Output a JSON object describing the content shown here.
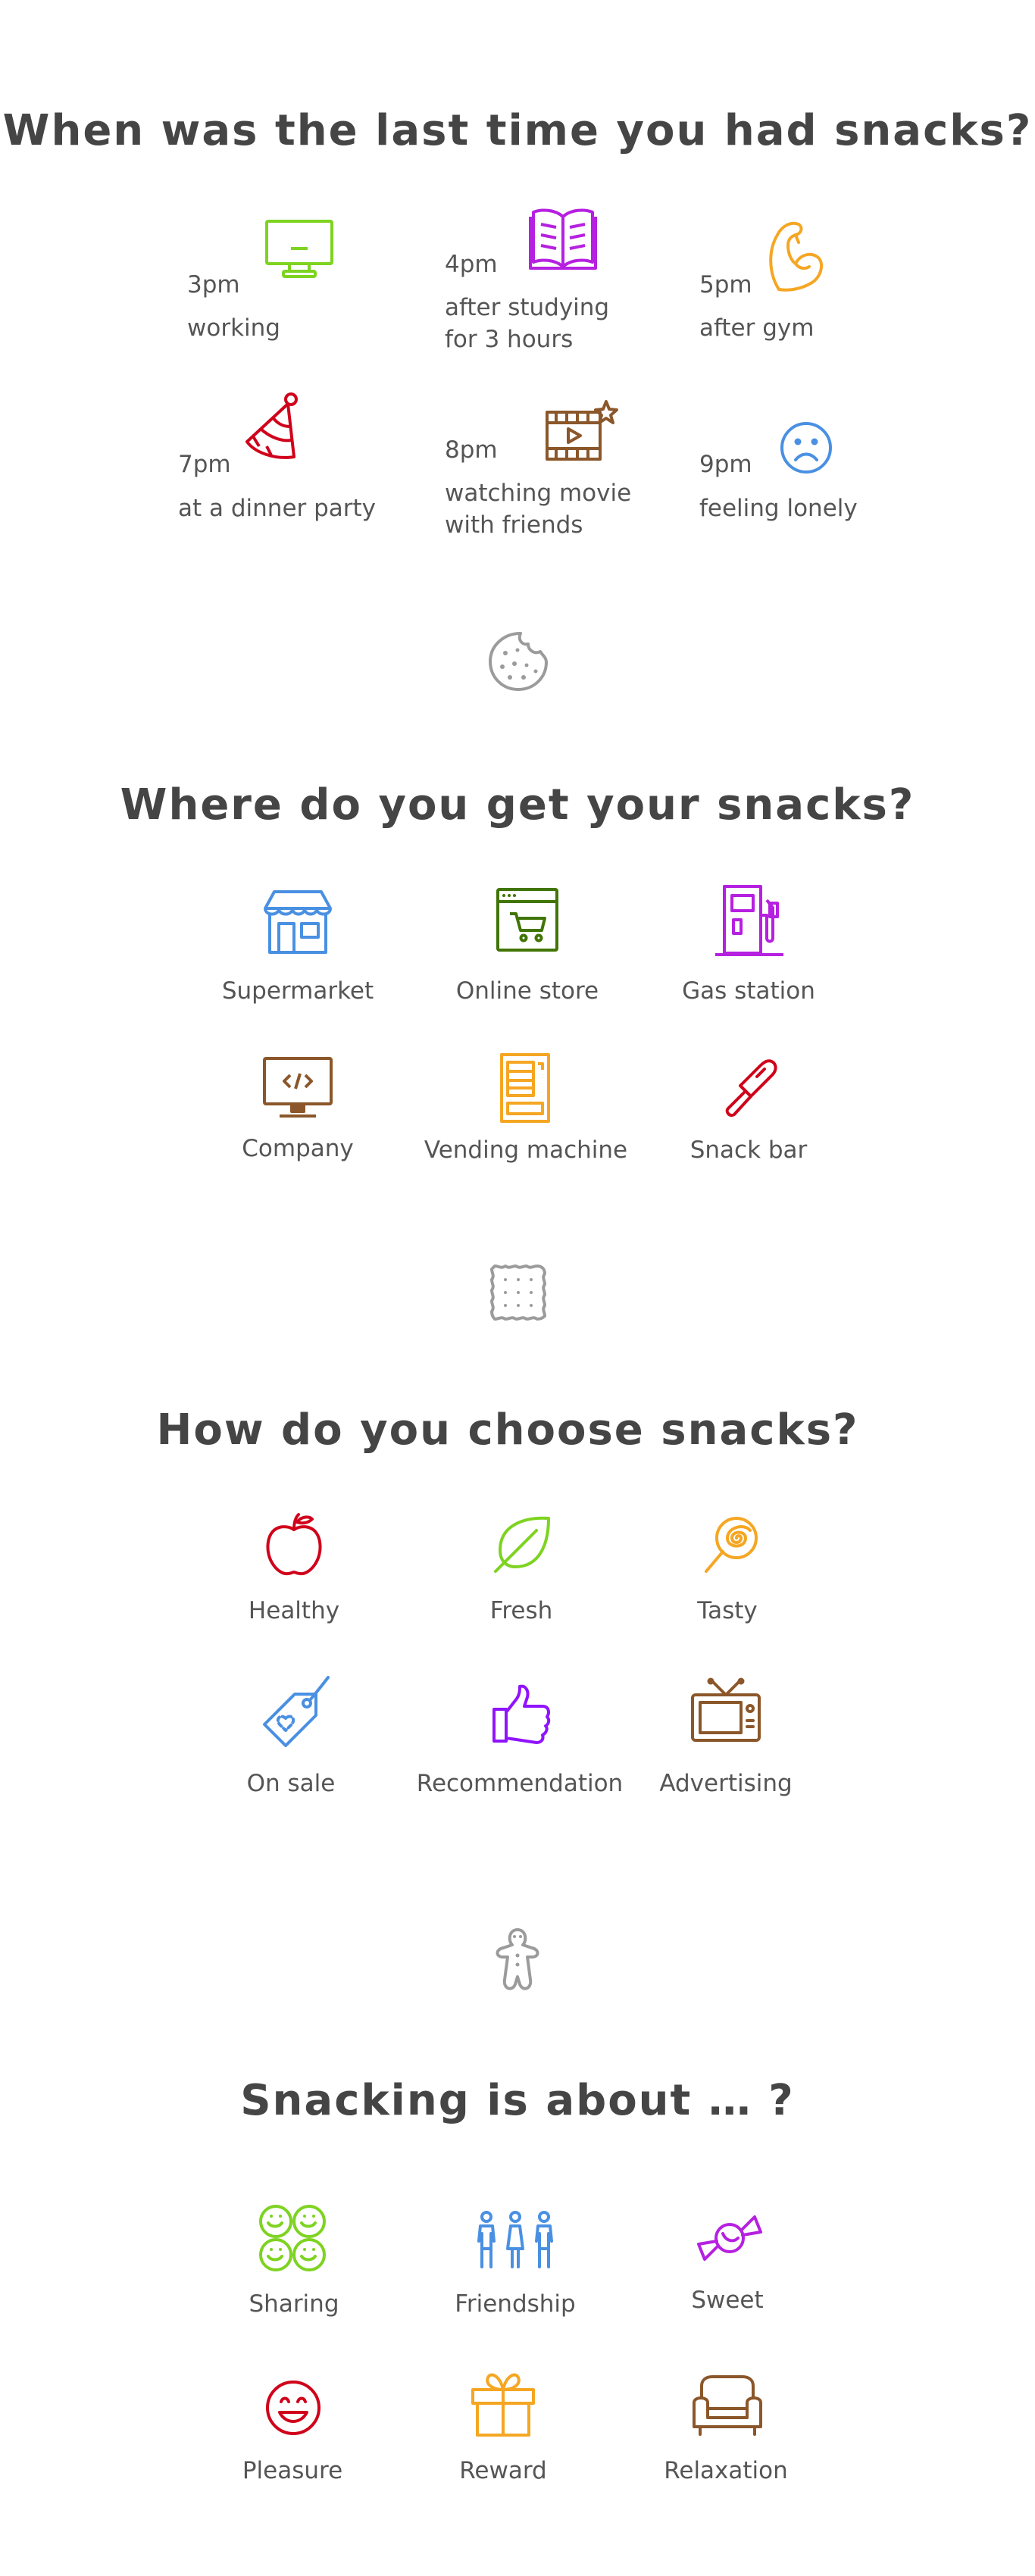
{
  "sections": {
    "when": {
      "title": "When was the last time you had snacks?",
      "items": [
        {
          "time": "3pm",
          "desc": "working",
          "icon": "monitor-icon",
          "color": "#7ed321"
        },
        {
          "time": "4pm",
          "desc_line1": "after studying",
          "desc_line2": "for 3 hours",
          "icon": "open-book-icon",
          "color": "#b620e0"
        },
        {
          "time": "5pm",
          "desc": "after gym",
          "icon": "flexed-arm-icon",
          "color": "#f5a623"
        },
        {
          "time": "7pm",
          "desc": "at a dinner party",
          "icon": "party-hat-icon",
          "color": "#d0021b"
        },
        {
          "time": "8pm",
          "desc_line1": "watching movie",
          "desc_line2": "with friends",
          "icon": "film-clapper-icon",
          "color": "#8b572a"
        },
        {
          "time": "9pm",
          "desc": "feeling lonely",
          "icon": "sad-face-icon",
          "color": "#4a90e2"
        }
      ]
    },
    "where": {
      "title": "Where do you get your snacks?",
      "items": [
        {
          "label": "Supermarket",
          "icon": "store-icon",
          "color": "#4a90e2"
        },
        {
          "label": "Online store",
          "icon": "online-cart-icon",
          "color": "#417505"
        },
        {
          "label": "Gas station",
          "icon": "fuel-pump-icon",
          "color": "#b620e0"
        },
        {
          "label": "Company",
          "icon": "computer-code-icon",
          "color": "#8b572a"
        },
        {
          "label": "Vending machine",
          "icon": "vending-machine-icon",
          "color": "#f5a623"
        },
        {
          "label": "Snack bar",
          "icon": "popsicle-icon",
          "color": "#d0021b"
        }
      ]
    },
    "how": {
      "title": "How do you choose snacks?",
      "items": [
        {
          "label": "Healthy",
          "icon": "apple-icon",
          "color": "#d0021b"
        },
        {
          "label": "Fresh",
          "icon": "leaf-icon",
          "color": "#7ed321"
        },
        {
          "label": "Tasty",
          "icon": "lollipop-icon",
          "color": "#f5a623"
        },
        {
          "label": "On sale",
          "icon": "price-tag-icon",
          "color": "#4a90e2"
        },
        {
          "label": "Recommendation",
          "icon": "thumbs-up-icon",
          "color": "#9013fe"
        },
        {
          "label": "Advertising",
          "icon": "tv-icon",
          "color": "#8b572a"
        }
      ]
    },
    "about": {
      "title": "Snacking is about … ?",
      "items": [
        {
          "label": "Sharing",
          "icon": "cookies-icon",
          "color": "#7ed321"
        },
        {
          "label": "Friendship",
          "icon": "friends-icon",
          "color": "#4a90e2"
        },
        {
          "label": "Sweet",
          "icon": "candy-icon",
          "color": "#b620e0"
        },
        {
          "label": "Pleasure",
          "icon": "smile-icon",
          "color": "#d0021b"
        },
        {
          "label": "Reward",
          "icon": "gift-icon",
          "color": "#f5a623"
        },
        {
          "label": "Relaxation",
          "icon": "armchair-icon",
          "color": "#8b572a"
        }
      ]
    }
  },
  "dividers": [
    "bitten-cookie-icon",
    "cracker-icon",
    "gingerbread-man-icon"
  ],
  "divider_color": "#9b9b9b"
}
